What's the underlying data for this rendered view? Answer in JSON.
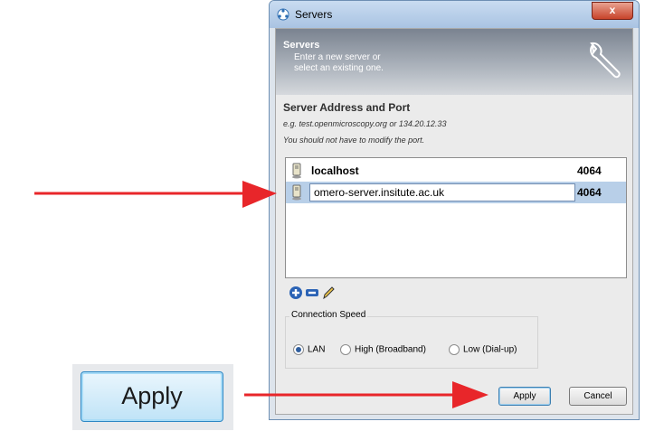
{
  "window": {
    "title": "Servers",
    "close_label": "x"
  },
  "banner": {
    "title": "Servers",
    "desc_line1": "Enter a new server or",
    "desc_line2": "select an existing one."
  },
  "section": {
    "title": "Server Address and Port",
    "hint1": "e.g. test.openmicroscopy.org or 134.20.12.33",
    "hint2": "You should not have to modify the port."
  },
  "servers": [
    {
      "host": "localhost",
      "port": "4064"
    },
    {
      "host": "omero-server.insitute.ac.uk",
      "port": "4064"
    }
  ],
  "connection_speed": {
    "label": "Connection Speed",
    "options": [
      "LAN",
      "High (Broadband)",
      "Low (Dial-up)"
    ],
    "selected": "LAN"
  },
  "buttons": {
    "apply": "Apply",
    "cancel": "Cancel"
  },
  "callout": {
    "apply_label": "Apply"
  },
  "colors": {
    "arrow": "#e8262a",
    "selection": "#b8cfe8",
    "accent": "#3c7fb1"
  },
  "icons": [
    "servers-app-icon",
    "wrench-icon",
    "server-icon",
    "add-icon",
    "remove-icon",
    "edit-pencil-icon"
  ]
}
